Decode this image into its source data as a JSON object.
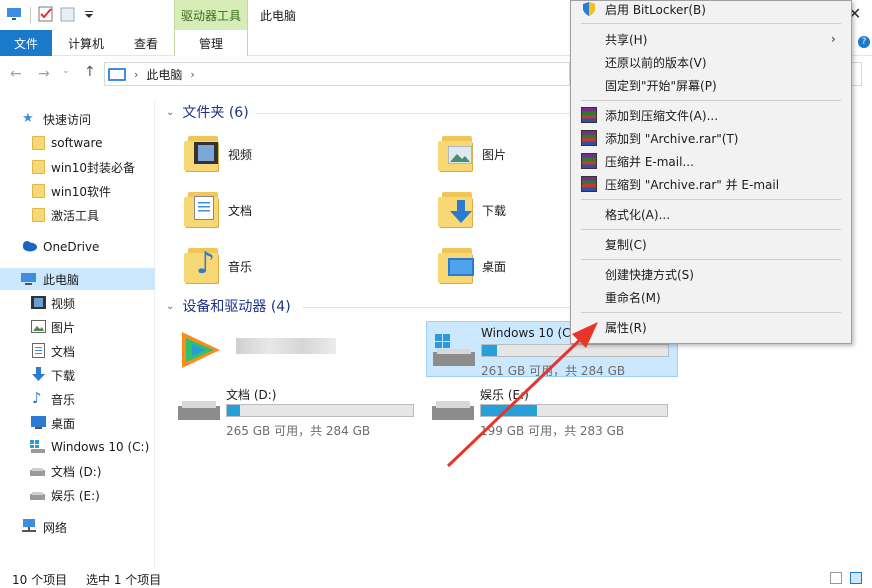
{
  "titlebar": {
    "context_tab": "驱动器工具",
    "window_title": "此电脑"
  },
  "ribbon": {
    "tabs": [
      "文件",
      "计算机",
      "查看",
      "管理"
    ]
  },
  "address": {
    "path": "此电脑"
  },
  "sidebar": {
    "quick_access": "快速访问",
    "pinned": [
      "software",
      "win10封装必备",
      "win10软件",
      "激活工具"
    ],
    "onedrive": "OneDrive",
    "this_pc": "此电脑",
    "pc_items": [
      "视频",
      "图片",
      "文档",
      "下载",
      "音乐",
      "桌面",
      "Windows 10 (C:)",
      "文档 (D:)",
      "娱乐 (E:)"
    ],
    "network": "网络"
  },
  "content": {
    "folders_header": "文件夹 (6)",
    "folders": [
      "视频",
      "图片",
      "文档",
      "下载",
      "音乐",
      "桌面"
    ],
    "devices_header": "设备和驱动器 (4)",
    "drives": [
      {
        "name": "Windows 10 (C:)",
        "info": "261 GB 可用，共 284 GB",
        "used_fraction": 0.08
      },
      {
        "name": "文档 (D:)",
        "info": "265 GB 可用，共 284 GB",
        "used_fraction": 0.07
      },
      {
        "name": "娱乐 (E:)",
        "info": "199 GB 可用，共 283 GB",
        "used_fraction": 0.3
      }
    ]
  },
  "context_menu": {
    "items": [
      "启用 BitLocker(B)",
      "共享(H)",
      "还原以前的版本(V)",
      "固定到\"开始\"屏幕(P)",
      "添加到压缩文件(A)...",
      "添加到 \"Archive.rar\"(T)",
      "压缩并 E-mail...",
      "压缩到 \"Archive.rar\" 并 E-mail",
      "格式化(A)...",
      "复制(C)",
      "创建快捷方式(S)",
      "重命名(M)",
      "属性(R)"
    ]
  },
  "status": {
    "count": "10 个项目",
    "selected": "选中 1 个项目"
  },
  "colors": {
    "accent": "#1979ca",
    "selection": "#cce8ff",
    "progress": "#26a0da",
    "annotation_arrow": "#e8352a"
  }
}
